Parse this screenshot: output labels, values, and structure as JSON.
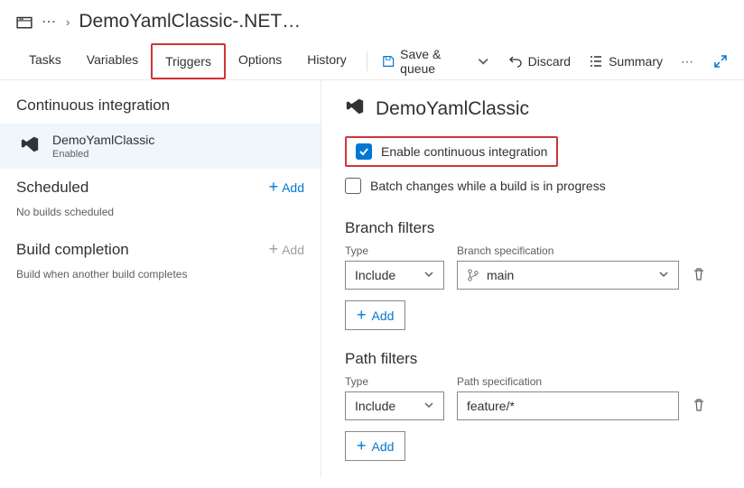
{
  "header": {
    "breadcrumb_sep": "›",
    "title": "DemoYamlClassic-.NET…"
  },
  "tabs": {
    "items": [
      "Tasks",
      "Variables",
      "Triggers",
      "Options",
      "History"
    ],
    "active_index": 2
  },
  "toolbar": {
    "save_label": "Save & queue",
    "discard_label": "Discard",
    "summary_label": "Summary"
  },
  "sidebar": {
    "ci_section": "Continuous integration",
    "repo_name": "DemoYamlClassic",
    "repo_status": "Enabled",
    "scheduled_section": "Scheduled",
    "scheduled_note": "No builds scheduled",
    "add_label": "Add",
    "build_completion_section": "Build completion",
    "build_completion_note": "Build when another build completes"
  },
  "panel": {
    "title": "DemoYamlClassic",
    "enable_ci_label": "Enable continuous integration",
    "batch_label": "Batch changes while a build is in progress",
    "branch_filters_heading": "Branch filters",
    "path_filters_heading": "Path filters",
    "type_label": "Type",
    "branch_spec_label": "Branch specification",
    "path_spec_label": "Path specification",
    "branch_filter": {
      "type": "Include",
      "spec": "main"
    },
    "path_filter": {
      "type": "Include",
      "spec": "feature/*"
    },
    "add_label": "Add"
  }
}
